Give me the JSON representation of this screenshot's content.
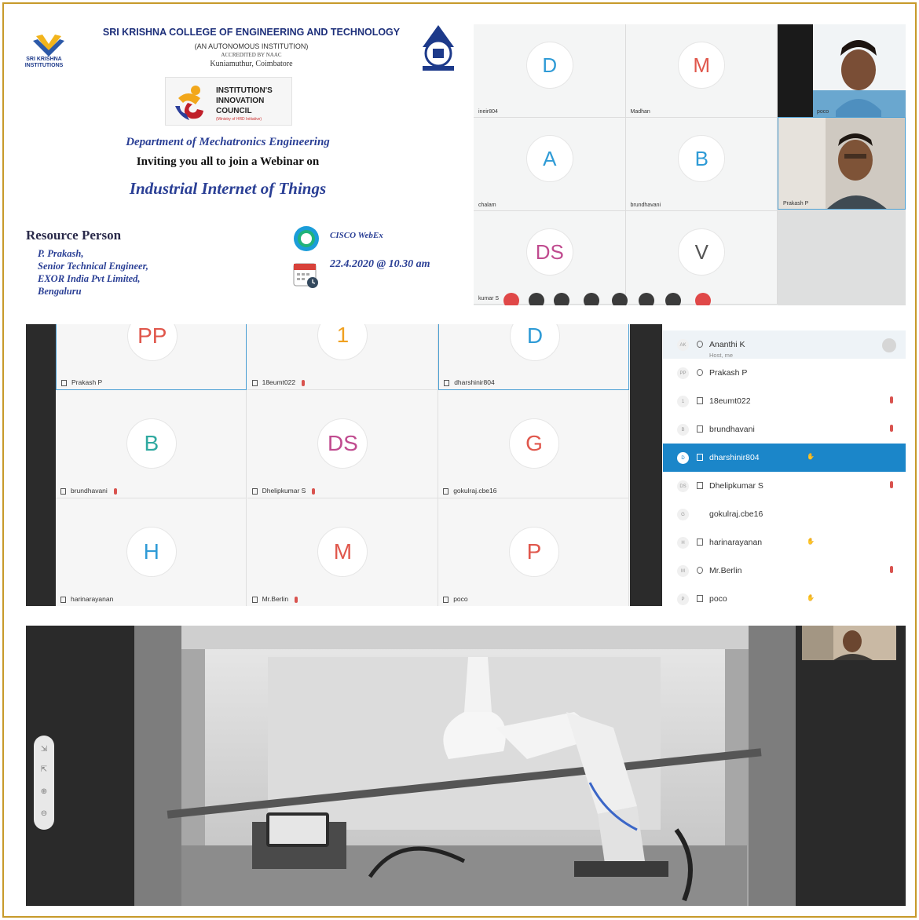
{
  "poster": {
    "logo_left_text": "SRI KRISHNA INSTITUTIONS",
    "college_name": "SRI KRISHNA COLLEGE OF ENGINEERING AND TECHNOLOGY",
    "autonomous": "(AN AUTONOMOUS INSTITUTION)",
    "accredited": "ACCREDITED BY NAAC",
    "location": "Kuniamuthur, Coimbatore",
    "iic_lines": [
      "INSTITUTION'S",
      "INNOVATION",
      "COUNCIL"
    ],
    "iic_ministry": "(Ministry of HRD Initiative)",
    "department": "Department of Mechatronics Engineering",
    "invite": "Inviting you all to join a Webinar on",
    "topic": "Industrial Internet of Things",
    "resource_title": "Resource Person",
    "resource_lines": [
      "P. Prakash,",
      "Senior Technical Engineer,",
      "EXOR India Pvt Limited,",
      "Bengaluru"
    ],
    "platform": "CISCO WebEx",
    "datetime": "22.4.2020 @ 10.30 am"
  },
  "meeting_top": {
    "tiles": [
      {
        "initial": "D",
        "label": "ineir804",
        "color": "#2f9bd6"
      },
      {
        "initial": "M",
        "label": "Madhan",
        "color": "#e0574c"
      },
      {
        "initial": "A",
        "label": "chalam",
        "color": "#2f9bd6"
      },
      {
        "initial": "B",
        "label": "brundhavani",
        "color": "#2f9bd6"
      },
      {
        "initial": "DS",
        "label": "kumar S",
        "color": "#c04b8f"
      },
      {
        "initial": "V",
        "label": "",
        "color": "#555555"
      }
    ],
    "camera_tiles": [
      {
        "label": "poco"
      },
      {
        "label": "Prakash P"
      }
    ]
  },
  "meeting_grid": {
    "tiles": [
      {
        "initial": "PP",
        "label": "Prakash P",
        "color": "#e0574c",
        "active": true,
        "mic_muted": false
      },
      {
        "initial": "1",
        "label": "18eumt022",
        "color": "#f0a020",
        "active": false,
        "mic_muted": true
      },
      {
        "initial": "D",
        "label": "dharshinir804",
        "color": "#2f9bd6",
        "active": true,
        "mic_muted": false
      },
      {
        "initial": "B",
        "label": "brundhavani",
        "color": "#2fa9a0",
        "active": false,
        "mic_muted": true
      },
      {
        "initial": "DS",
        "label": "Dhelipkumar S",
        "color": "#c04b8f",
        "active": false,
        "mic_muted": true
      },
      {
        "initial": "G",
        "label": "gokulraj.cbe16",
        "color": "#e0574c",
        "active": false,
        "mic_muted": false
      },
      {
        "initial": "H",
        "label": "harinarayanan",
        "color": "#2f9bd6",
        "active": false,
        "mic_muted": false
      },
      {
        "initial": "M",
        "label": "Mr.Berlin",
        "color": "#e0574c",
        "active": false,
        "mic_muted": true
      },
      {
        "initial": "P",
        "label": "poco",
        "color": "#e0574c",
        "active": false,
        "mic_muted": false
      }
    ]
  },
  "participants": [
    {
      "avatar": "AK",
      "name": "Ananthi K",
      "sub": "Host, me",
      "hand": false,
      "muted": false,
      "selected": false
    },
    {
      "avatar": "PP",
      "name": "Prakash P",
      "sub": "",
      "hand": false,
      "muted": false,
      "selected": false
    },
    {
      "avatar": "1",
      "name": "18eumt022",
      "sub": "",
      "hand": false,
      "muted": true,
      "selected": false
    },
    {
      "avatar": "B",
      "name": "brundhavani",
      "sub": "",
      "hand": false,
      "muted": true,
      "selected": false
    },
    {
      "avatar": "D",
      "name": "dharshinir804",
      "sub": "",
      "hand": true,
      "muted": false,
      "selected": true
    },
    {
      "avatar": "DS",
      "name": "Dhelipkumar S",
      "sub": "",
      "hand": false,
      "muted": true,
      "selected": false
    },
    {
      "avatar": "G",
      "name": "gokulraj.cbe16",
      "sub": "",
      "hand": false,
      "muted": false,
      "selected": false
    },
    {
      "avatar": "H",
      "name": "harinarayanan",
      "sub": "",
      "hand": true,
      "muted": false,
      "selected": false
    },
    {
      "avatar": "M",
      "name": "Mr.Berlin",
      "sub": "",
      "hand": false,
      "muted": true,
      "selected": false
    },
    {
      "avatar": "P",
      "name": "poco",
      "sub": "",
      "hand": true,
      "muted": false,
      "selected": false
    }
  ],
  "share_zoom": [
    "⇲",
    "⇱",
    "⊕",
    "⊖"
  ],
  "icons": {
    "hand": "raise-hand-icon",
    "mic": "mic-muted-icon",
    "camera": "camera-off-icon"
  }
}
